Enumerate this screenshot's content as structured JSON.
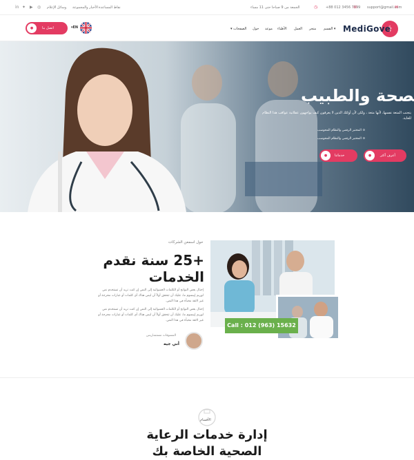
{
  "topbar": {
    "email": "support@gmail.com",
    "phone": "+88 012 3456 7899",
    "hours": "الجمعة من 9 صباحا حتى 11 مساء",
    "links": [
      "نقاط المساعدة",
      "الأخبار والمجموعة",
      "وسائل الإعلام"
    ],
    "social": [
      "in",
      "tw",
      "yt",
      "ig"
    ]
  },
  "header": {
    "logo": "MediGove",
    "lang": "EN",
    "cta": "اتصل بنا",
    "nav": [
      "القسم",
      "متجر",
      "العمل",
      "الأطباء",
      "موعد",
      "حول",
      "الصفحات"
    ]
  },
  "hero": {
    "title": "الصحة والطبيب",
    "desc": "يتجنب المتعة نفسها، لأنها متعة ، ولكن لأن أولئك الذين لا يعرفون كيف يواجهون عقلانية عواقب هذا النظام للغاية.",
    "checks": [
      "المختبر الرقمي والنظام المحوسب",
      "المختبر الرقمي والنظام المحوسب"
    ],
    "btn_more": "أعرف أكثر",
    "btn_services": "خدماتنا"
  },
  "about": {
    "subtitle": "حول اسمعن الشركات",
    "title_line1": "+25 سنة نقدم",
    "title_line2": "الخدمات",
    "para1": "إحتال بعض النواتج أو الكلمات العشوائية إلى النص إن كنت تريد أن تستخدم نص لوريم إيبسوم ما، عليك أن تتحقق أولاً أن ليس هناك أي كلمات أو عبارات محرجة أو غير لائقة مخبأة في هذا النص.",
    "para2": "إحتال بعض النواتج أو الكلمات العشوائية إلى النص إن كنت تريد أن تستخدم نص لوريم إيبسوم ما، عليك أن تتحقق أولاً أن ليس هناك أي كلمات أو عبارات محرجة أو غير لائقة مخبأة في هذا النص.",
    "author_name": "أني جيه",
    "author_role": "المسوقات مستشاريس",
    "call": "Call : 012 (963) 15632"
  },
  "departments": {
    "label": "الأقسام",
    "title": "إدارة خدمات الرعاية الصحية الخاصة بك"
  },
  "colors": {
    "accent": "#e33b62",
    "call": "#6ab04c"
  }
}
